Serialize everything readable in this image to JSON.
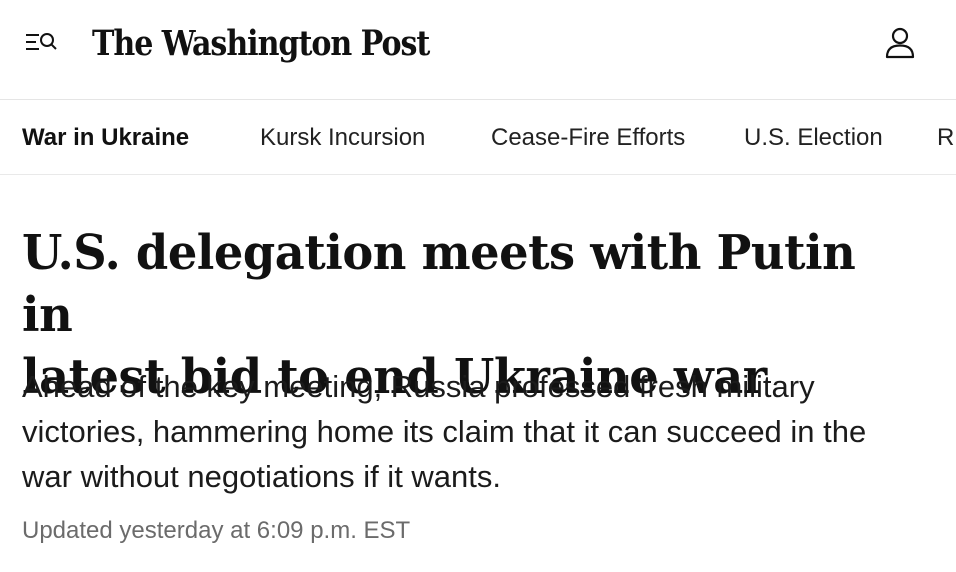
{
  "header": {
    "masthead": "The Washington Post",
    "menu_icon": "menu-search-icon",
    "account_icon": "user-icon"
  },
  "nav": {
    "items": [
      {
        "label": "War in Ukraine",
        "active": true
      },
      {
        "label": "Kursk Incursion"
      },
      {
        "label": "Cease-Fire Efforts"
      },
      {
        "label": "U.S. Election"
      },
      {
        "label": "R"
      }
    ]
  },
  "article": {
    "headline_line1": "U.S. delegation meets with Putin in",
    "headline_line2": "latest bid to end Ukraine war",
    "dek_line1": "Ahead of the key meeting, Russia professed fresh military",
    "dek_line2": "victories, hammering home its claim that it can succeed in the",
    "dek_line3": "war without negotiations if it wants.",
    "timestamp": "Updated yesterday at 6:09 p.m. EST"
  },
  "colors": {
    "text": "#111111",
    "timestamp": "#6b6b6b",
    "divider": "#e5e5e5"
  }
}
